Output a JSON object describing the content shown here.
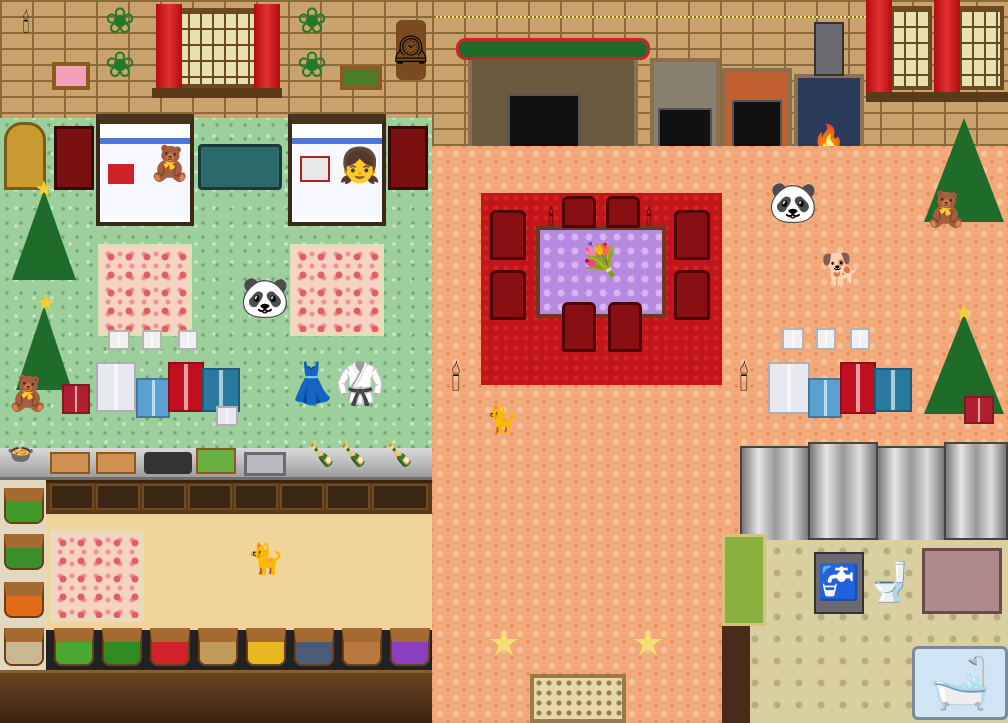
{
  "scene": {
    "palette": {
      "wall": "#c9a36b",
      "green_floor": "#9ccf9c",
      "peach_floor": "#f2a878",
      "red_carpet": "#c0161a",
      "table_cloth": "#b58ae0",
      "curtain": "#d01c20"
    },
    "icons": {
      "panda": "🐼",
      "cat": "🐈",
      "dog": "🐕",
      "bear": "🧸",
      "star": "★",
      "wreath": "❀",
      "candle": "🕯",
      "clock": "🕰",
      "doll": "👧",
      "dress": "👗",
      "robe": "🥋",
      "bouquet": "💐",
      "sink": "🚰",
      "toilet": "🚽",
      "bathtub": "🛁",
      "fire": "🔥",
      "bottle": "🍾",
      "pot": "🍲"
    },
    "characters": [
      {
        "kind": "panda",
        "room": "bedroom"
      },
      {
        "kind": "panda",
        "room": "living-room"
      },
      {
        "kind": "cat",
        "room": "kitchen"
      },
      {
        "kind": "cat",
        "room": "living-room"
      },
      {
        "kind": "dog",
        "room": "living-room"
      }
    ],
    "produce_colors": [
      "#3f9a2a",
      "#3a8f2a",
      "#e06a16",
      "#c8b890",
      "#4aa830",
      "#2f8a22",
      "#d0222a",
      "#c49a5a",
      "#e8b820",
      "#4a5a78",
      "#b87840",
      "#8a3fc0"
    ]
  }
}
